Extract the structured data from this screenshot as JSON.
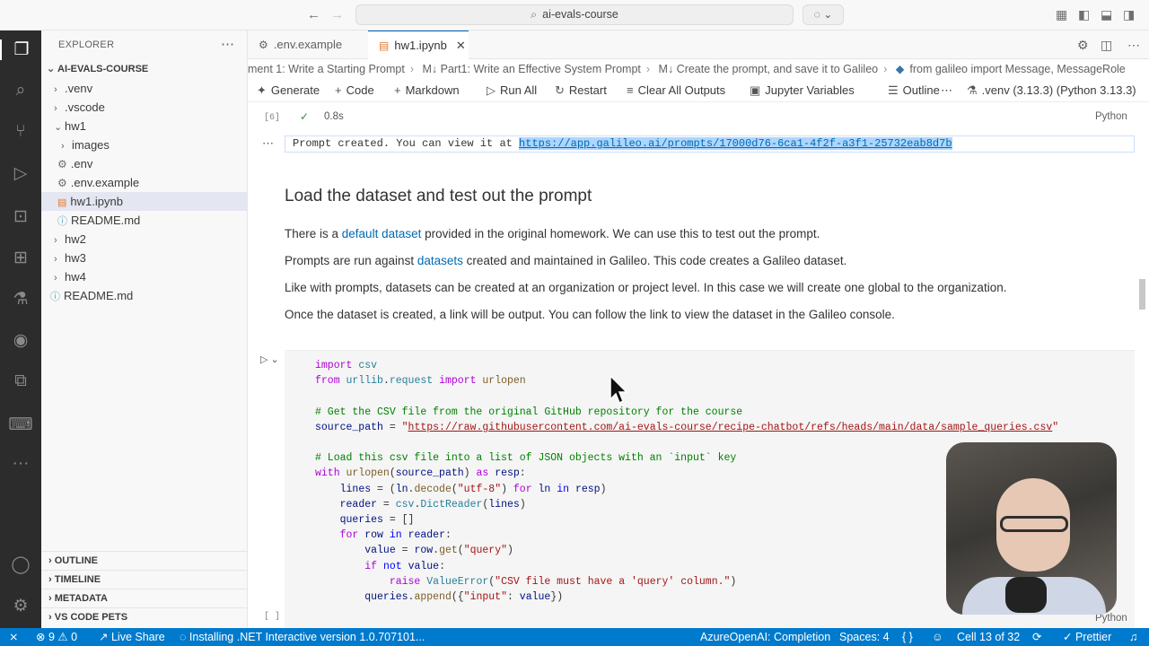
{
  "titlebar": {
    "search_text": "ai-evals-course"
  },
  "explorer": {
    "title": "EXPLORER",
    "root": "AI-EVALS-COURSE",
    "items": [
      {
        "label": ".venv"
      },
      {
        "label": ".vscode"
      },
      {
        "label": "hw1"
      },
      {
        "label": "images"
      },
      {
        "label": ".env"
      },
      {
        "label": ".env.example"
      },
      {
        "label": "hw1.ipynb"
      },
      {
        "label": "README.md"
      },
      {
        "label": "hw2"
      },
      {
        "label": "hw3"
      },
      {
        "label": "hw4"
      },
      {
        "label": "README.md"
      }
    ],
    "sections": [
      "OUTLINE",
      "TIMELINE",
      "METADATA",
      "VS CODE PETS"
    ]
  },
  "tabs": [
    {
      "label": ".env.example"
    },
    {
      "label": "hw1.ipynb"
    }
  ],
  "breadcrumbs": [
    "ment 1: Write a Starting Prompt",
    "M↓ Part1: Write an Effective System Prompt",
    "M↓ Create the prompt, and save it to Galileo",
    "from galileo import Message, MessageRole"
  ],
  "toolbar": {
    "generate": "Generate",
    "code": "Code",
    "markdown": "Markdown",
    "run_all": "Run All",
    "restart": "Restart",
    "clear_outputs": "Clear All Outputs",
    "jupyter_vars": "Jupyter Variables",
    "outline": "Outline",
    "kernel": ".venv (3.13.3) (Python 3.13.3)"
  },
  "cell6": {
    "count": "[6]",
    "time": "0.8s",
    "lang": "Python",
    "output_prefix": "Prompt created. You can view it at ",
    "output_link": "https://app.galileo.ai/prompts/17000d76-6ca1-4f2f-a3f1-25732eab8d7b"
  },
  "markdown": {
    "heading": "Load the dataset and test out the prompt",
    "p1_a": "There is a ",
    "p1_link": "default dataset",
    "p1_b": " provided in the original homework. We can use this to test out the prompt.",
    "p2_a": "Prompts are run against ",
    "p2_link": "datasets",
    "p2_b": " created and maintained in Galileo. This code creates a Galileo dataset.",
    "p3": "Like with prompts, datasets can be created at an organization or project level. In this case we will create one global to the organization.",
    "p4": "Once the dataset is created, a link will be output. You can follow the link to view the dataset in the Galileo console."
  },
  "code_cell": {
    "count": "[ ]",
    "lang": "Python",
    "comment1": "# Get the CSV file from the original GitHub repository for the course",
    "url": "https://raw.githubusercontent.com/ai-evals-course/recipe-chatbot/refs/heads/main/data/sample_queries.csv",
    "comment2": "# Load this csv file into a list of JSON objects with an `input` key",
    "error_msg": "\"CSV file must have a 'query' column.\""
  },
  "statusbar": {
    "errors": "9",
    "warnings": "0",
    "live_share": "Live Share",
    "installing": "Installing .NET Interactive version 1.0.707101...",
    "azure": "AzureOpenAI: Completion",
    "spaces": "Spaces: 4",
    "braces": "{ }",
    "cell": "Cell 13 of 32",
    "prettier": "Prettier"
  }
}
